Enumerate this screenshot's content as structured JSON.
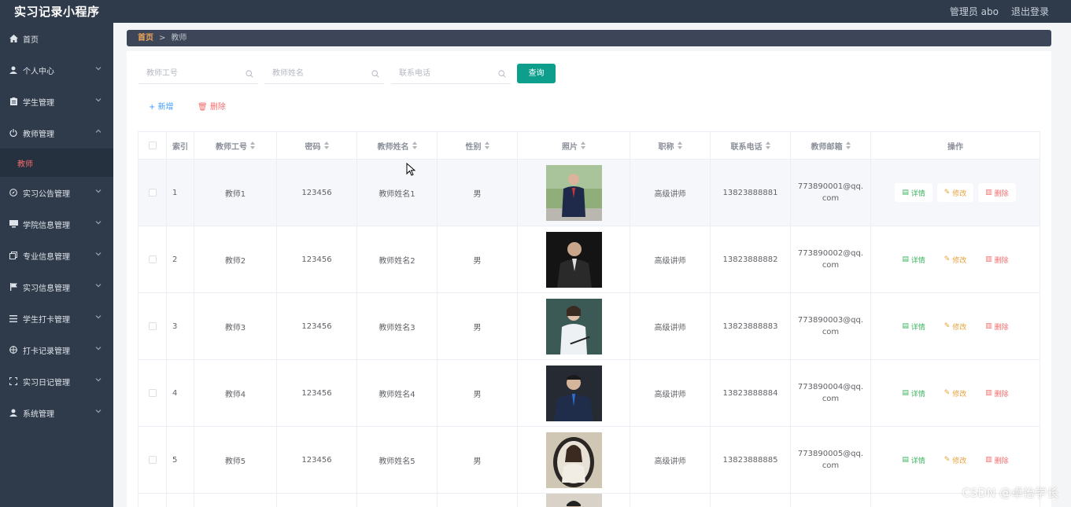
{
  "app": {
    "title": "实习记录小程序",
    "user": "管理员 abo",
    "logout": "退出登录"
  },
  "sidebar": {
    "items": [
      {
        "label": "首页",
        "icon": "home-icon"
      },
      {
        "label": "个人中心",
        "icon": "user-icon"
      },
      {
        "label": "学生管理",
        "icon": "clipboard-icon"
      },
      {
        "label": "教师管理",
        "icon": "power-icon"
      },
      {
        "label": "实习公告管理",
        "icon": "compass-icon"
      },
      {
        "label": "学院信息管理",
        "icon": "monitor-icon"
      },
      {
        "label": "专业信息管理",
        "icon": "copy-icon"
      },
      {
        "label": "实习信息管理",
        "icon": "flag-icon"
      },
      {
        "label": "学生打卡管理",
        "icon": "menu-icon"
      },
      {
        "label": "打卡记录管理",
        "icon": "target-icon"
      },
      {
        "label": "实习日记管理",
        "icon": "fullscreen-icon"
      },
      {
        "label": "系统管理",
        "icon": "user-icon"
      }
    ],
    "submenu_active": "教师"
  },
  "breadcrumb": {
    "home": "首页",
    "separator": ">",
    "current": "教师"
  },
  "search": {
    "teacher_id_placeholder": "教师工号",
    "teacher_name_placeholder": "教师姓名",
    "phone_placeholder": "联系电话",
    "query_label": "查询"
  },
  "actions": {
    "add_label": "新增",
    "delete_label": "删除"
  },
  "table": {
    "headers": [
      "索引",
      "教师工号",
      "密码",
      "教师姓名",
      "性别",
      "照片",
      "职称",
      "联系电话",
      "教师邮箱",
      "操作"
    ],
    "rows": [
      {
        "index": "1",
        "id": "教师1",
        "password": "123456",
        "name": "教师姓名1",
        "gender": "男",
        "title": "高级讲师",
        "phone": "13823888881",
        "email": "773890001@qq.com"
      },
      {
        "index": "2",
        "id": "教师2",
        "password": "123456",
        "name": "教师姓名2",
        "gender": "男",
        "title": "高级讲师",
        "phone": "13823888882",
        "email": "773890002@qq.com"
      },
      {
        "index": "3",
        "id": "教师3",
        "password": "123456",
        "name": "教师姓名3",
        "gender": "男",
        "title": "高级讲师",
        "phone": "13823888883",
        "email": "773890003@qq.com"
      },
      {
        "index": "4",
        "id": "教师4",
        "password": "123456",
        "name": "教师姓名4",
        "gender": "男",
        "title": "高级讲师",
        "phone": "13823888884",
        "email": "773890004@qq.com"
      },
      {
        "index": "5",
        "id": "教师5",
        "password": "123456",
        "name": "教师姓名5",
        "gender": "男",
        "title": "高级讲师",
        "phone": "13823888885",
        "email": "773890005@qq.com"
      }
    ],
    "op_detail": "详情",
    "op_edit": "修改",
    "op_delete": "删除"
  },
  "watermark": "CSDN @卓怡学长",
  "colors": {
    "sidebar_bg": "#2f3a4a",
    "query_btn": "#0d9f8c",
    "active_menu": "#f56c6c",
    "breadcrumb_home": "#f0a35b"
  }
}
